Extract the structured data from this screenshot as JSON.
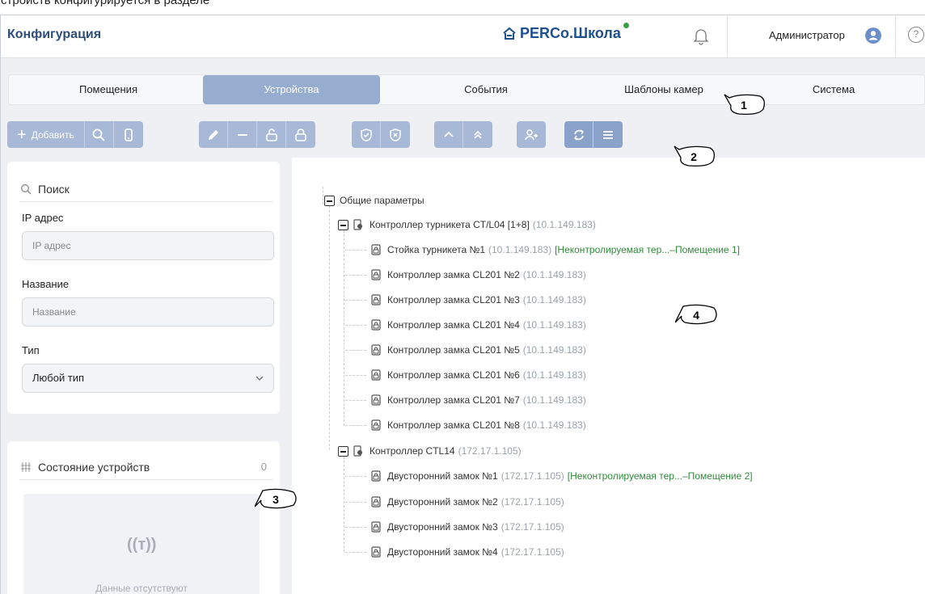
{
  "top_strip": "стройств конфигурируется в разделе",
  "header": {
    "title": "Конфигурация",
    "brand": "PERCo.Школа",
    "user": "Администратор",
    "help": "?"
  },
  "tabs": [
    {
      "label": "Помещения",
      "active": false
    },
    {
      "label": "Устройства",
      "active": true
    },
    {
      "label": "События",
      "active": false
    },
    {
      "label": "Шаблоны камер",
      "active": false
    },
    {
      "label": "Система",
      "active": false
    }
  ],
  "toolbar": {
    "add_label": "Добавить"
  },
  "filter": {
    "search_label": "Поиск",
    "ip_label": "IP адрес",
    "ip_placeholder": "IP адрес",
    "name_label": "Название",
    "name_placeholder": "Название",
    "type_label": "Тип",
    "type_value": "Любой тип"
  },
  "status": {
    "title": "Состояние устройств",
    "count": "0",
    "empty_icon": "((т))",
    "empty_text": "Данные отсутствуют"
  },
  "tree": {
    "root": "Общие параметры",
    "controllers": [
      {
        "name": "Контроллер турникета CT/L04 [1+8]",
        "ip": "(10.1.149.183)",
        "children": [
          {
            "name": "Стойка турникета №1",
            "ip": "(10.1.149.183)",
            "zone": "[Неконтролируемая тер...–Помещение 1]"
          },
          {
            "name": "Контроллер замка CL201 №2",
            "ip": "(10.1.149.183)",
            "zone": ""
          },
          {
            "name": "Контроллер замка CL201 №3",
            "ip": "(10.1.149.183)",
            "zone": ""
          },
          {
            "name": "Контроллер замка CL201 №4",
            "ip": "(10.1.149.183)",
            "zone": ""
          },
          {
            "name": "Контроллер замка CL201 №5",
            "ip": "(10.1.149.183)",
            "zone": ""
          },
          {
            "name": "Контроллер замка CL201 №6",
            "ip": "(10.1.149.183)",
            "zone": ""
          },
          {
            "name": "Контроллер замка CL201 №7",
            "ip": "(10.1.149.183)",
            "zone": ""
          },
          {
            "name": "Контроллер замка CL201 №8",
            "ip": "(10.1.149.183)",
            "zone": ""
          }
        ]
      },
      {
        "name": "Контроллер CTL14",
        "ip": "(172.17.1.105)",
        "children": [
          {
            "name": "Двусторонний замок №1",
            "ip": "(172.17.1.105)",
            "zone": "[Неконтролируемая тер...–Помещение 2]"
          },
          {
            "name": "Двусторонний замок №2",
            "ip": "(172.17.1.105)",
            "zone": ""
          },
          {
            "name": "Двусторонний замок №3",
            "ip": "(172.17.1.105)",
            "zone": ""
          },
          {
            "name": "Двусторонний замок №4",
            "ip": "(172.17.1.105)",
            "zone": ""
          }
        ]
      }
    ]
  },
  "callouts": [
    "1",
    "2",
    "3",
    "4"
  ],
  "colors": {
    "accent": "#97add0",
    "toolbar": "#a7b9d6",
    "zone_text": "#2f8a3a",
    "brand": "#1f4f8f",
    "brand_dot": "#36a047"
  }
}
